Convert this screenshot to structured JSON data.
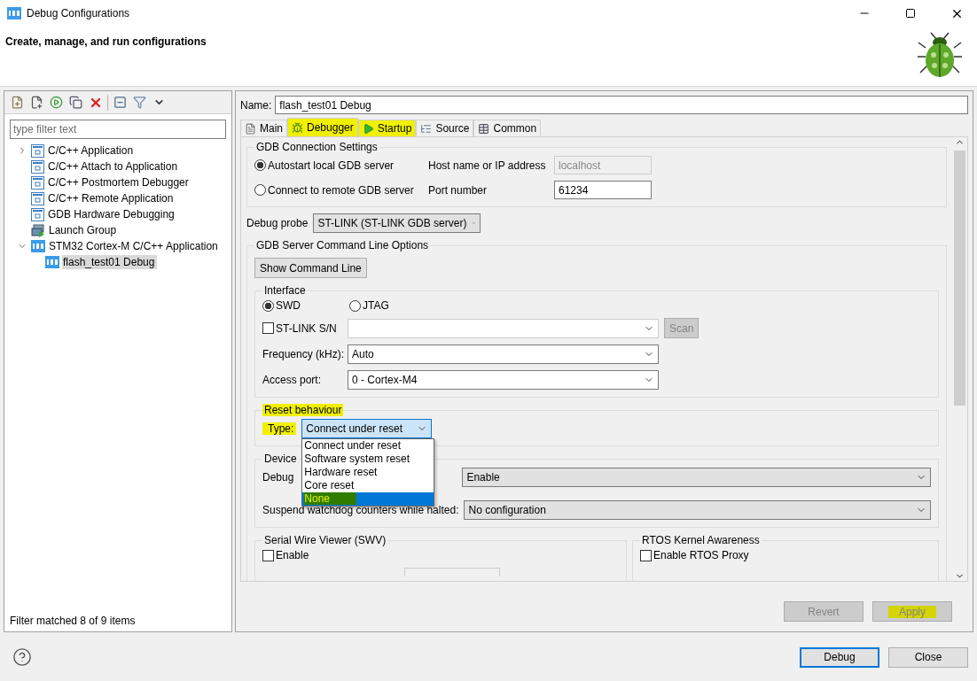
{
  "window": {
    "title": "Debug Configurations"
  },
  "header": {
    "title": "Create, manage, and run configurations"
  },
  "sidebar": {
    "filter": {
      "placeholder": "type filter text"
    },
    "tree": [
      {
        "label": "C/C++ Application",
        "kind": "c",
        "expanded": false,
        "selected": false
      },
      {
        "label": "C/C++ Attach to Application",
        "kind": "c",
        "selected": false
      },
      {
        "label": "C/C++ Postmortem Debugger",
        "kind": "c",
        "selected": false
      },
      {
        "label": "C/C++ Remote Application",
        "kind": "c",
        "selected": false
      },
      {
        "label": "GDB Hardware Debugging",
        "kind": "c",
        "selected": false
      },
      {
        "label": "Launch Group",
        "kind": "group",
        "selected": false
      },
      {
        "label": "STM32 Cortex-M C/C++ Application",
        "kind": "ide",
        "expanded": true,
        "selected": false,
        "children": [
          {
            "label": "flash_test01 Debug",
            "kind": "ide",
            "selected": true
          }
        ]
      }
    ],
    "status": "Filter matched 8 of 9 items"
  },
  "editor": {
    "name_label": "Name:",
    "name_value": "flash_test01 Debug",
    "tabs": [
      {
        "label": "Main",
        "selected": false,
        "highlighted": false
      },
      {
        "label": "Debugger",
        "selected": true,
        "highlighted": true
      },
      {
        "label": "Startup",
        "selected": false,
        "highlighted": true
      },
      {
        "label": "Source",
        "selected": false,
        "highlighted": false
      },
      {
        "label": "Common",
        "selected": false,
        "highlighted": false
      }
    ],
    "connection": {
      "title": "GDB Connection Settings",
      "options": [
        {
          "label": "Autostart local GDB server",
          "selected": true
        },
        {
          "label": "Connect to remote GDB server",
          "selected": false
        }
      ],
      "host_label": "Host name or IP address",
      "host_value": "localhost",
      "host_disabled": true,
      "port_label": "Port number",
      "port_value": "61234"
    },
    "probe_label": "Debug probe",
    "probe_value": "ST-LINK (ST-LINK GDB server)",
    "server_options": {
      "title": "GDB Server Command Line Options",
      "show_button": "Show Command Line",
      "interface": {
        "title": "Interface",
        "options": [
          {
            "label": "SWD",
            "selected": true
          },
          {
            "label": "JTAG",
            "selected": false
          }
        ],
        "serial_label": "ST-LINK S/N",
        "serial_checked": false,
        "scan_button": "Scan",
        "scan_disabled": true,
        "frequency_label": "Frequency (kHz):",
        "frequency_value": "Auto",
        "port_label": "Access port:",
        "port_value": "0 - Cortex-M4"
      },
      "reset": {
        "title": "Reset behaviour",
        "highlighted": true,
        "type_label": "Type:",
        "type_highlighted": true,
        "type_value": "Connect under reset",
        "expanded": true,
        "options": [
          {
            "label": "Connect under reset",
            "selected": false,
            "highlighted": false
          },
          {
            "label": "Software system reset",
            "selected": false,
            "highlighted": false
          },
          {
            "label": "Hardware reset",
            "selected": false,
            "highlighted": false
          },
          {
            "label": "Core reset",
            "selected": false,
            "highlighted": false
          },
          {
            "label": "None",
            "selected": true,
            "highlighted": true
          }
        ]
      },
      "device": {
        "title": "Device",
        "rows": [
          {
            "label": "Debug",
            "value": "Enable"
          },
          {
            "label": "Suspend watchdog counters while halted:",
            "value": "No configuration"
          }
        ]
      },
      "swv": {
        "title": "Serial Wire Viewer (SWV)",
        "label": "Enable",
        "checked": false
      },
      "rtos": {
        "title": "RTOS Kernel Awareness",
        "label": "Enable RTOS Proxy",
        "checked": false
      }
    },
    "revert": {
      "label": "Revert",
      "disabled": true,
      "highlighted": false
    },
    "apply": {
      "label": "Apply",
      "disabled": true,
      "highlighted": true
    }
  },
  "footer": {
    "buttons": [
      {
        "label": "Debug",
        "default": true
      },
      {
        "label": "Close",
        "default": false
      }
    ]
  }
}
